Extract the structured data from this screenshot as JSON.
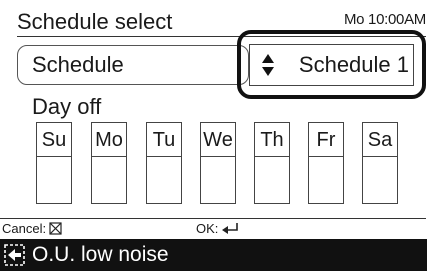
{
  "header": {
    "title": "Schedule select",
    "clock": "Mo 10:00AM"
  },
  "schedule_field": {
    "label": "Schedule",
    "value": "Schedule 1",
    "arrows_icon": "up-down-triangles-icon"
  },
  "day_off": {
    "label": "Day off",
    "days": [
      {
        "label": "Su"
      },
      {
        "label": "Mo"
      },
      {
        "label": "Tu"
      },
      {
        "label": "We"
      },
      {
        "label": "Th"
      },
      {
        "label": "Fr"
      },
      {
        "label": "Sa"
      }
    ]
  },
  "footer": {
    "cancel_label": "Cancel:",
    "cancel_icon": "cancel-x-icon",
    "ok_label": "OK:",
    "ok_icon": "enter-arrow-icon"
  },
  "status_bar": {
    "label": "O.U. low noise",
    "icon": "low-noise-icon"
  }
}
